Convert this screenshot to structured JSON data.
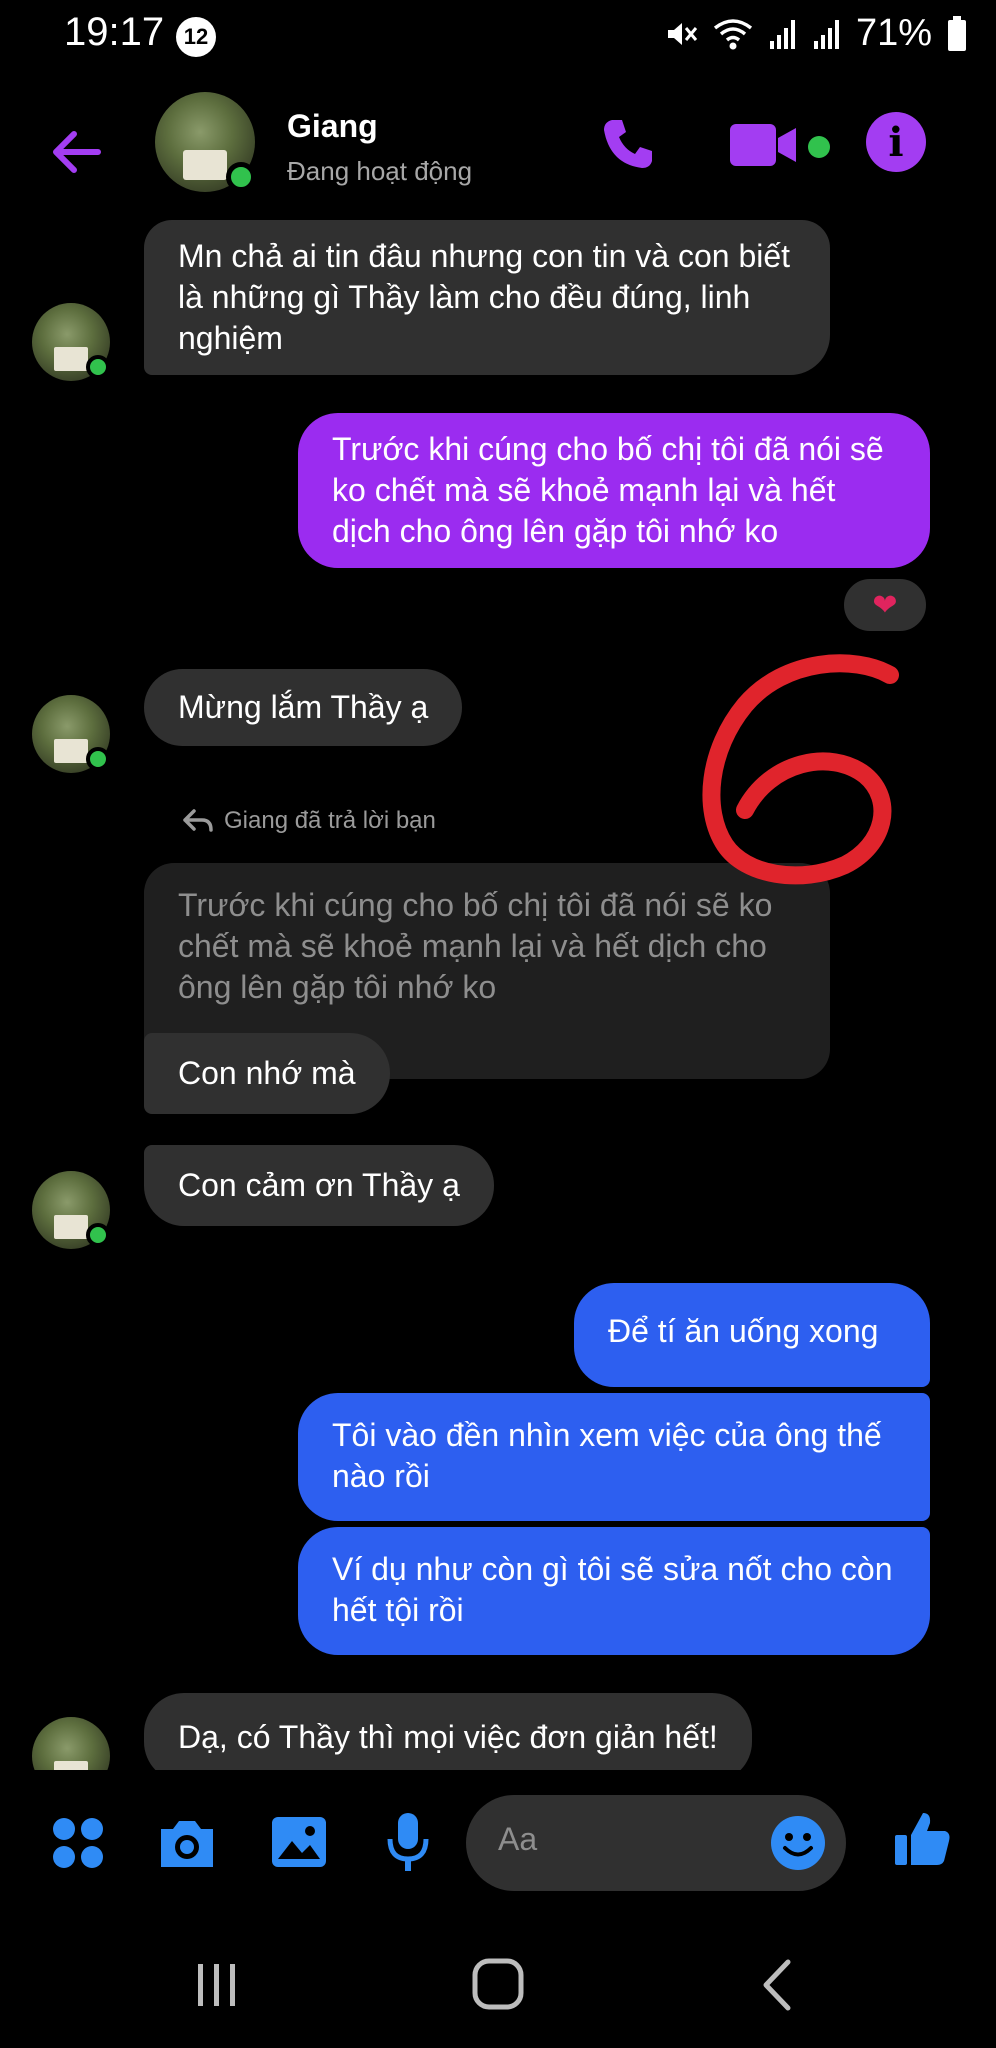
{
  "status_bar": {
    "time": "19:17",
    "notification_count": "12",
    "battery": "71%",
    "icons": [
      "mute-icon",
      "wifi-icon",
      "signal-icon",
      "signal-icon",
      "battery-icon"
    ]
  },
  "header": {
    "name": "Giang",
    "status": "Đang hoạt động",
    "icons": [
      "back-arrow-icon",
      "phone-icon",
      "video-camera-icon",
      "info-icon"
    ],
    "accent_color": "#a33df2"
  },
  "messages": [
    {
      "from": "contact",
      "text": "Mn chả ai tin đâu nhưng con tin và con biết là những gì Thầy làm cho đều đúng, linh nghiệm"
    },
    {
      "from": "me",
      "text": "Trước khi cúng cho bố chị tôi đã nói sẽ ko chết mà sẽ khoẻ mạnh lại và hết dịch cho ông lên gặp tôi nhớ ko",
      "reaction": "heart"
    },
    {
      "from": "contact",
      "text": "Mừng lắm Thầy ạ"
    },
    {
      "from": "contact",
      "reply_label": "Giang đã trả lời bạn",
      "quoted_text": "Trước khi cúng cho bố chị tôi đã nói sẽ ko chết mà sẽ khoẻ mạnh lại và hết dịch cho ông lên gặp tôi nhớ ko",
      "text": "Con nhớ mà"
    },
    {
      "from": "contact",
      "text": "Con cảm ơn Thầy ạ"
    },
    {
      "from": "me",
      "text": "Để tí ăn uống xong"
    },
    {
      "from": "me",
      "text": "Tôi vào đền nhìn xem việc của ông thế nào rồi"
    },
    {
      "from": "me",
      "text": "Ví dụ như còn gì tôi sẽ sửa nốt cho còn hết tội rồi"
    },
    {
      "from": "contact",
      "text": "Dạ, có Thầy thì mọi việc đơn giản hết!"
    }
  ],
  "annotation": {
    "text": "6",
    "color": "#e0242c"
  },
  "composer": {
    "placeholder": "Aa",
    "icons": [
      "menu-grid-icon",
      "camera-icon",
      "image-icon",
      "microphone-icon",
      "emoji-icon",
      "thumbs-up-icon"
    ]
  },
  "navbar": {
    "icons": [
      "recent-apps-icon",
      "home-icon",
      "back-icon"
    ]
  }
}
